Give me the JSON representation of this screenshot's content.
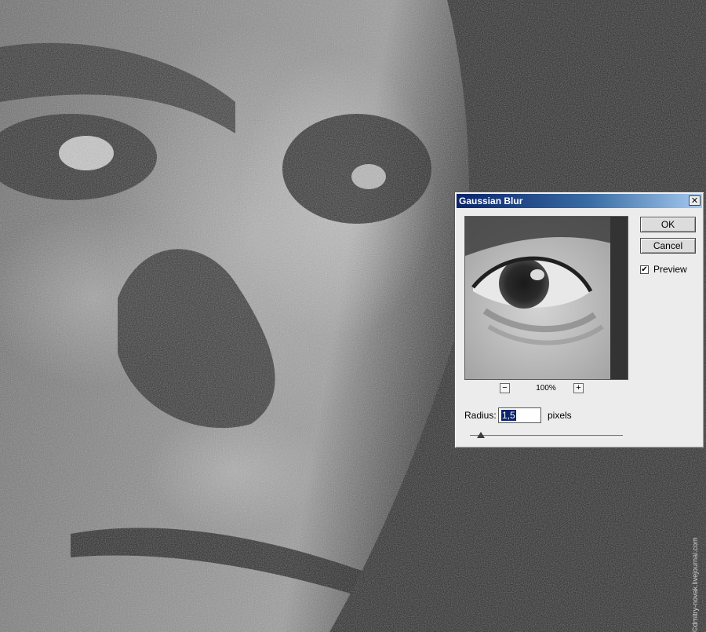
{
  "dialog": {
    "title": "Gaussian Blur",
    "close_glyph": "✕",
    "ok_label": "OK",
    "cancel_label": "Cancel",
    "preview_label": "Preview",
    "preview_checked": true,
    "zoom_out_glyph": "−",
    "zoom_in_glyph": "+",
    "zoom_level": "100%",
    "radius_label": "Radius:",
    "radius_value": "1,5",
    "radius_units": "pixels",
    "radius_slider_fraction": 0.07
  },
  "watermark": "©dmitry-novak.livejournal.com",
  "colors": {
    "titlebar_start": "#0a246a",
    "titlebar_end": "#a6caf0",
    "dialog_bg": "#ececec"
  },
  "icons": {
    "close": "close-icon",
    "zoom_out": "minus-icon",
    "zoom_in": "plus-icon",
    "checkbox": "check-icon"
  }
}
